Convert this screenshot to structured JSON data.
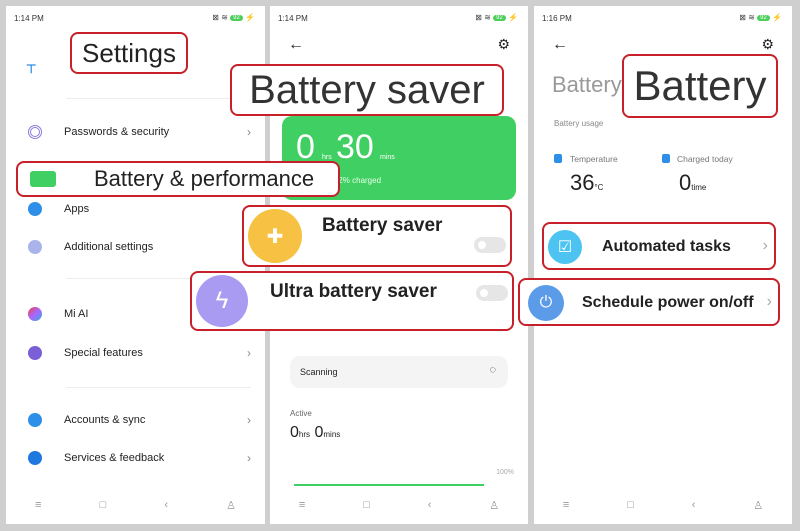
{
  "colors": {
    "accent_red": "#c8202a",
    "battery_green": "#3fcf62",
    "saver_yellow": "#f7c143",
    "ultra_purple": "#a99bf2"
  },
  "panel1": {
    "time": "1:14 PM",
    "battery_level": "92",
    "title": "Settings",
    "items": [
      {
        "label": "Passwords & security",
        "icon": "fingerprint-icon"
      },
      {
        "label": "Battery & performance",
        "icon": "battery-icon"
      },
      {
        "label": "Apps",
        "icon": "gear-icon"
      },
      {
        "label": "Additional settings",
        "icon": "more-icon"
      },
      {
        "label": "Mi AI",
        "icon": "mi-ai-icon"
      },
      {
        "label": "Special features",
        "icon": "special-features-icon"
      },
      {
        "label": "Accounts & sync",
        "icon": "person-icon"
      },
      {
        "label": "Services & feedback",
        "icon": "help-icon"
      }
    ]
  },
  "panel2": {
    "time": "1:14 PM",
    "battery_level": "92",
    "title": "Battery saver",
    "hours": "0",
    "hrs_unit": "hrs",
    "mins": "30",
    "mins_unit": "mins",
    "charge_status": "/ charged | 92% charged",
    "battery_saver": "Battery saver",
    "ultra_saver": "Ultra battery saver",
    "battery_saver_on": false,
    "ultra_saver_on": false,
    "scanning": "Scanning",
    "active_label": "Active",
    "active_hours": "0",
    "active_hrs_unit": "hrs",
    "active_mins": "0",
    "active_mins_unit": "mins",
    "chart_max": "100%"
  },
  "panel3": {
    "time": "1:16 PM",
    "battery_level": "92",
    "header_small": "Battery",
    "title": "Battery",
    "usage_label": "Battery usage",
    "temperature_label": "Temperature",
    "temperature_value": "36",
    "temperature_unit": "°C",
    "charged_label": "Charged today",
    "charged_value": "0",
    "charged_unit": "time",
    "automated_tasks": "Automated tasks",
    "schedule_power": "Schedule power on/off"
  }
}
